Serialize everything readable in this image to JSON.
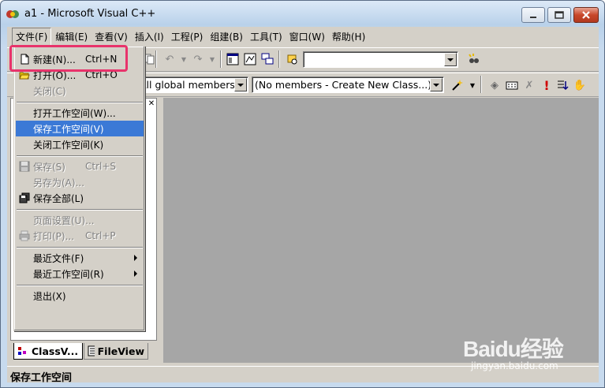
{
  "window": {
    "title": "a1 - Microsoft Visual C++",
    "colors": {
      "workspace": "#a6a6a6",
      "highlight": "#3b79d6",
      "callout": "#e8336b"
    }
  },
  "menubar": {
    "items": [
      "文件(F)",
      "编辑(E)",
      "查看(V)",
      "插入(I)",
      "工程(P)",
      "组建(B)",
      "工具(T)",
      "窗口(W)",
      "帮助(H)"
    ]
  },
  "toolbar": {
    "find_combo_value": "",
    "class_combo_value": "All global members",
    "members_combo_value": "(No members - Create New Class...)"
  },
  "file_menu": {
    "new": {
      "label": "新建(N)...",
      "shortcut": "Ctrl+N"
    },
    "open": {
      "label": "打开(O)...",
      "shortcut": "Ctrl+O"
    },
    "close": {
      "label": "关闭(C)"
    },
    "open_workspace": {
      "label": "打开工作空间(W)..."
    },
    "save_workspace": {
      "label": "保存工作空间(V)"
    },
    "close_workspace": {
      "label": "关闭工作空间(K)"
    },
    "save": {
      "label": "保存(S)",
      "shortcut": "Ctrl+S"
    },
    "save_as": {
      "label": "另存为(A)..."
    },
    "save_all": {
      "label": "保存全部(L)"
    },
    "page_setup": {
      "label": "页面设置(U)..."
    },
    "print": {
      "label": "打印(P)...",
      "shortcut": "Ctrl+P"
    },
    "recent_files": {
      "label": "最近文件(F)"
    },
    "recent_workspaces": {
      "label": "最近工作空间(R)"
    },
    "exit": {
      "label": "退出(X)"
    }
  },
  "left_pane": {
    "tabs": [
      "ClassV...",
      "FileView"
    ]
  },
  "statusbar": {
    "text": "保存工作空间"
  },
  "watermark": {
    "logo": "Baidu经验",
    "url": "jingyan.baidu.com"
  }
}
